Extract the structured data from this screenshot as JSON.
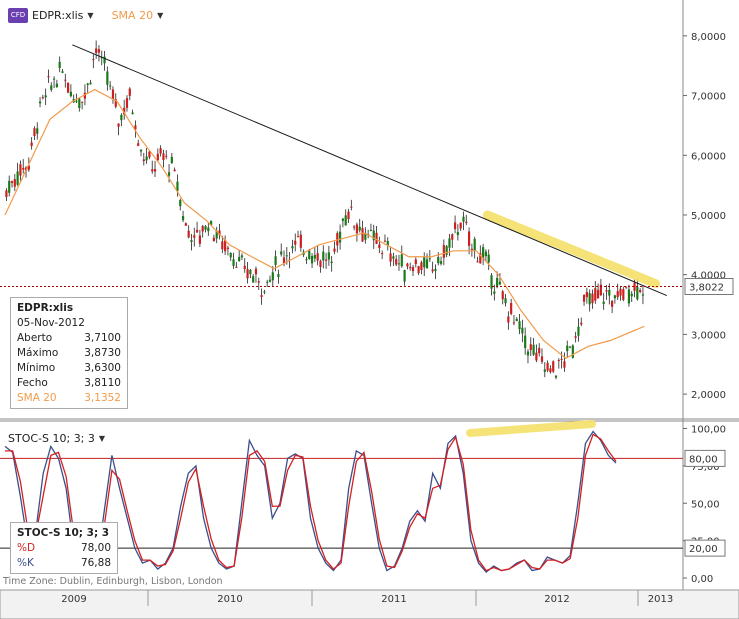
{
  "header": {
    "badge": "CFD",
    "symbol": "EDPR:xlis",
    "sma_label": "SMA 20",
    "stoch_label": "STOC-S 10; 3; 3"
  },
  "infobox": {
    "title": "EDPR:xlis",
    "date": "05-Nov-2012",
    "rows": [
      {
        "label": "Aberto",
        "value": "3,7100"
      },
      {
        "label": "Máximo",
        "value": "3,8730"
      },
      {
        "label": "Mínimo",
        "value": "3,6300"
      },
      {
        "label": "Fecho",
        "value": "3,8110"
      },
      {
        "label": "SMA 20",
        "value": "3,1352"
      }
    ]
  },
  "stoch_box": {
    "title": "STOC-S 10; 3; 3",
    "rows": [
      {
        "label": "%D",
        "value": "78,00"
      },
      {
        "label": "%K",
        "value": "76,88"
      }
    ]
  },
  "timezone": "Time Zone: Dublin, Edinburgh, Lisbon, London",
  "colors": {
    "candle_up": "#1a7a1a",
    "candle_down": "#cc1f1f",
    "sma": "#f29a4a",
    "trend": "#1a1a1a",
    "highlight": "#f5e06a",
    "price_line": "#a00000",
    "stoch_k": "#3a4f8c",
    "stoch_d": "#d52020",
    "level_line": "#c42020"
  },
  "chart_data": [
    {
      "type": "candlestick",
      "title": "EDPR:xlis",
      "last_price_label": "3,8022",
      "y_ticks": [
        "2,0000",
        "3,0000",
        "4,0000",
        "5,0000",
        "6,0000",
        "7,0000",
        "8,0000"
      ],
      "ylim": [
        1.6,
        8.6
      ],
      "x_ticks": [
        "2009",
        "2010",
        "2011",
        "2012",
        "2013"
      ],
      "series": [
        {
          "name": "EDPR:xlis",
          "x_weeks": [
            0,
            4,
            8,
            12,
            16,
            20,
            24,
            28,
            32,
            36,
            40,
            44,
            48,
            52,
            56,
            60,
            64,
            68,
            72,
            76,
            80,
            84,
            88,
            92,
            96,
            100,
            104,
            108,
            112,
            116,
            120,
            122,
            126,
            130,
            134,
            138,
            142,
            146,
            150,
            154,
            158,
            162,
            166,
            170,
            174,
            178,
            182,
            186,
            190,
            194,
            198,
            202,
            206,
            210,
            212,
            216,
            220,
            224,
            228
          ],
          "close": [
            5.4,
            5.7,
            5.9,
            6.8,
            7.2,
            7.4,
            7.0,
            7.0,
            7.8,
            7.3,
            6.6,
            7.0,
            6.1,
            5.8,
            6.0,
            5.7,
            4.8,
            4.6,
            4.9,
            4.6,
            4.4,
            4.1,
            4.0,
            3.8,
            4.1,
            4.4,
            4.5,
            4.4,
            4.3,
            4.2,
            4.9,
            5.1,
            4.8,
            4.6,
            4.5,
            4.3,
            4.1,
            4.2,
            4.1,
            4.2,
            4.5,
            4.9,
            4.5,
            4.3,
            3.9,
            3.5,
            3.2,
            2.8,
            2.6,
            2.4,
            2.5,
            2.8,
            3.5,
            3.6,
            3.7,
            3.6,
            3.7,
            3.8,
            3.81
          ]
        },
        {
          "name": "SMA 20",
          "x_weeks": [
            0,
            8,
            16,
            24,
            32,
            40,
            48,
            56,
            64,
            72,
            80,
            88,
            96,
            104,
            112,
            120,
            128,
            136,
            144,
            152,
            160,
            168,
            176,
            184,
            192,
            200,
            208,
            216,
            228
          ],
          "values": [
            5.0,
            5.8,
            6.6,
            6.9,
            7.1,
            6.9,
            6.3,
            5.8,
            5.2,
            4.9,
            4.5,
            4.3,
            4.1,
            4.3,
            4.5,
            4.6,
            4.7,
            4.5,
            4.3,
            4.3,
            4.4,
            4.4,
            4.0,
            3.4,
            2.9,
            2.6,
            2.8,
            2.9,
            3.1352
          ]
        }
      ],
      "trendline": {
        "from": [
          24,
          7.85
        ],
        "to": [
          236,
          3.65
        ]
      },
      "highlight_segment": {
        "from": [
          172,
          5.0
        ],
        "to": [
          232,
          3.85
        ]
      }
    },
    {
      "type": "line",
      "title": "STOC-S 10; 3; 3",
      "y_ticks": [
        "0,00",
        "25,00",
        "50,00",
        "75,00",
        "100,00"
      ],
      "ylim": [
        -8,
        105
      ],
      "levels": [
        {
          "value": 80,
          "label": "80,00"
        },
        {
          "value": 20,
          "label": "20,00"
        }
      ],
      "series": [
        {
          "name": "%K",
          "values": [
            88,
            84,
            55,
            22,
            30,
            70,
            88,
            80,
            60,
            20,
            5,
            12,
            8,
            45,
            82,
            60,
            40,
            20,
            10,
            12,
            6,
            10,
            20,
            48,
            70,
            75,
            40,
            20,
            10,
            6,
            8,
            50,
            92,
            82,
            75,
            40,
            50,
            80,
            83,
            80,
            40,
            20,
            10,
            5,
            12,
            60,
            85,
            82,
            50,
            20,
            5,
            8,
            20,
            38,
            45,
            38,
            70,
            60,
            90,
            95,
            70,
            25,
            10,
            4,
            8,
            5,
            6,
            10,
            12,
            5,
            6,
            14,
            12,
            10,
            15,
            50,
            90,
            98,
            92,
            82,
            76.88
          ]
        },
        {
          "name": "%D",
          "values": [
            85,
            85,
            65,
            32,
            28,
            55,
            82,
            84,
            68,
            30,
            8,
            10,
            10,
            35,
            72,
            66,
            45,
            25,
            12,
            12,
            8,
            9,
            18,
            40,
            64,
            73,
            48,
            26,
            12,
            7,
            8,
            40,
            82,
            85,
            78,
            48,
            48,
            72,
            82,
            81,
            48,
            25,
            12,
            6,
            10,
            48,
            78,
            84,
            58,
            26,
            8,
            7,
            18,
            34,
            43,
            40,
            60,
            62,
            86,
            94,
            76,
            32,
            12,
            5,
            7,
            5,
            6,
            9,
            12,
            7,
            6,
            12,
            12,
            10,
            13,
            40,
            82,
            96,
            93,
            85,
            78.0
          ]
        }
      ]
    }
  ]
}
